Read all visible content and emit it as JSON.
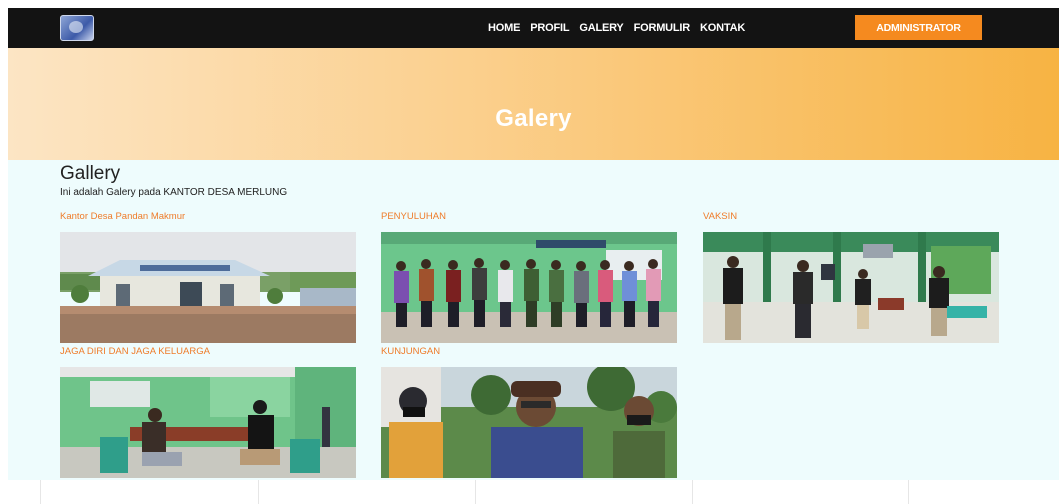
{
  "nav": {
    "links": [
      "HOME",
      "PROFIL",
      "GALERY",
      "FORMULIR",
      "KONTAK"
    ],
    "admin_label": "ADMINISTRATOR"
  },
  "hero": {
    "title": "Galery"
  },
  "section": {
    "title": "Gallery",
    "subtitle": "Ini adalah Galery pada KANTOR DESA MERLUNG"
  },
  "gallery": [
    {
      "caption": "Kantor Desa Pandan Makmur"
    },
    {
      "caption": "PENYULUHAN"
    },
    {
      "caption": "VAKSIN"
    },
    {
      "caption": "JAGA DIRI DAN JAGA KELUARGA"
    },
    {
      "caption": "KUNJUNGAN"
    }
  ],
  "colors": {
    "navbar": "#131313",
    "accent": "#f58a1f",
    "caption": "#ef7c2a",
    "page_bg": "#eefcfd"
  }
}
